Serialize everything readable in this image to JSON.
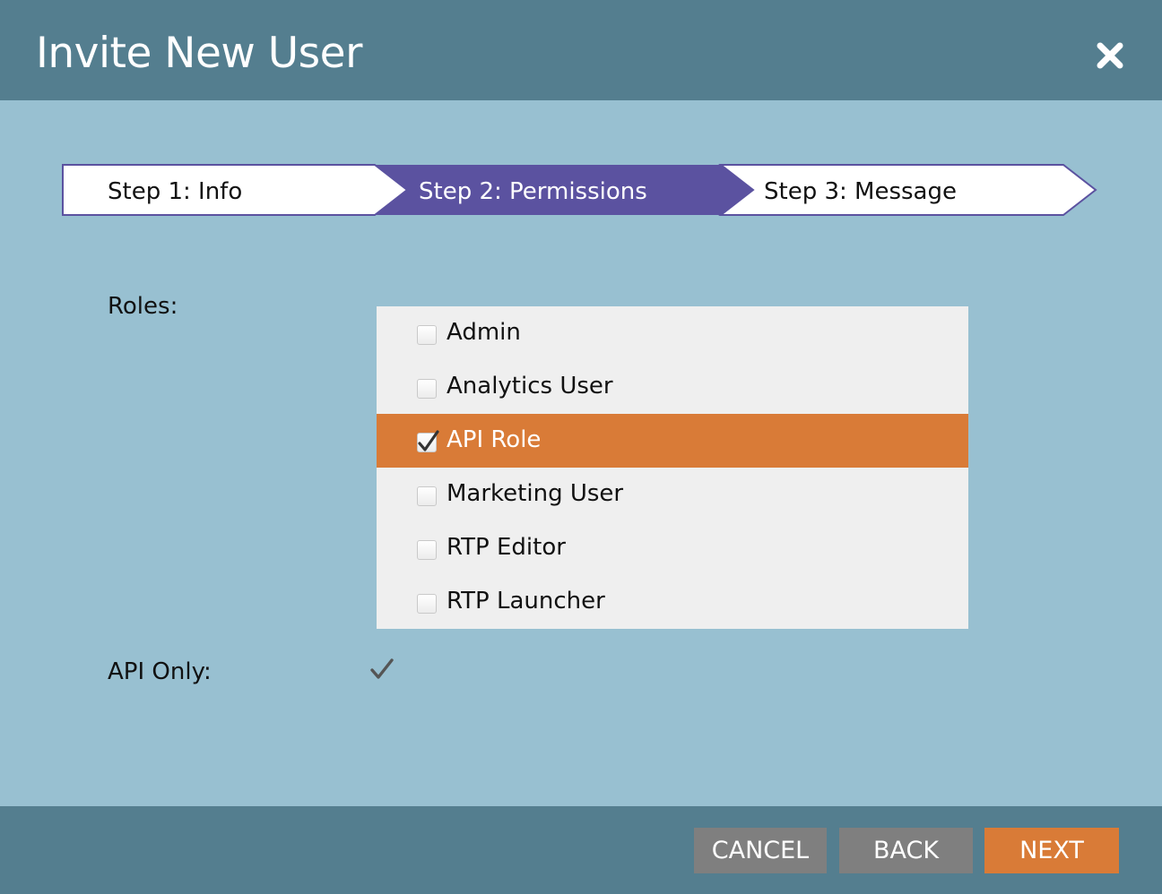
{
  "dialog": {
    "title": "Invite New User",
    "close_icon": "close-icon"
  },
  "wizard": {
    "steps": [
      {
        "label": "Step 1: Info",
        "state": "completed"
      },
      {
        "label": "Step 2: Permissions",
        "state": "active"
      },
      {
        "label": "Step 3: Message",
        "state": "upcoming"
      }
    ],
    "colors": {
      "active": "#5b52a0",
      "inactive": "#ffffff"
    }
  },
  "form": {
    "roles_label": "Roles:",
    "roles": [
      {
        "label": "Admin",
        "checked": false,
        "selected": false
      },
      {
        "label": "Analytics User",
        "checked": false,
        "selected": false
      },
      {
        "label": "API Role",
        "checked": true,
        "selected": true
      },
      {
        "label": "Marketing User",
        "checked": false,
        "selected": false
      },
      {
        "label": "RTP Editor",
        "checked": false,
        "selected": false
      },
      {
        "label": "RTP Launcher",
        "checked": false,
        "selected": false
      }
    ],
    "api_only_label": "API Only:",
    "api_only_checked": true
  },
  "footer": {
    "cancel_label": "CANCEL",
    "back_label": "BACK",
    "next_label": "NEXT"
  },
  "colors": {
    "header": "#547e8f",
    "body": "#98c0d1",
    "accent": "#d97b37",
    "button_gray": "#7f7f7f"
  }
}
